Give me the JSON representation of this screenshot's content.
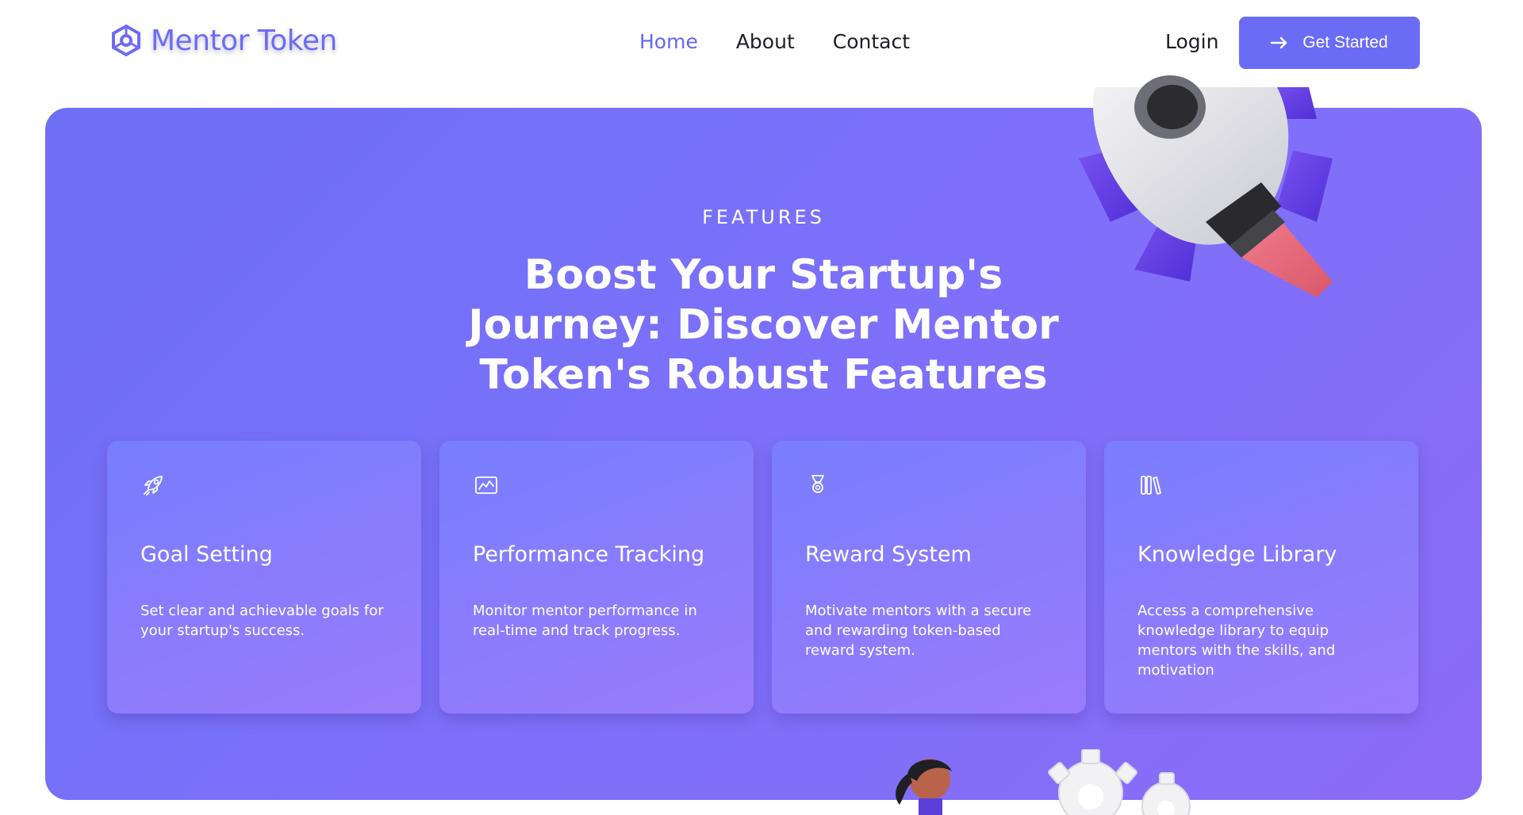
{
  "header": {
    "brand_name": "Mentor Token",
    "nav": [
      {
        "label": "Home",
        "active": true
      },
      {
        "label": "About",
        "active": false
      },
      {
        "label": "Contact",
        "active": false
      }
    ],
    "login_label": "Login",
    "cta_label": "Get Started"
  },
  "hero": {
    "eyebrow": "FEATURES",
    "title": "Boost Your Startup's Journey: Discover Mentor Token's Robust Features",
    "cards": [
      {
        "icon": "rocket-icon",
        "title": "Goal Setting",
        "description": "Set clear and achievable goals for your startup's success."
      },
      {
        "icon": "chart-icon",
        "title": "Performance Tracking",
        "description": "Monitor mentor performance in real-time and track progress."
      },
      {
        "icon": "medal-icon",
        "title": "Reward System",
        "description": "Motivate mentors with a secure and rewarding token-based reward system."
      },
      {
        "icon": "books-icon",
        "title": "Knowledge Library",
        "description": "Access a comprehensive knowledge library to equip mentors with the skills, and motivation"
      }
    ]
  },
  "colors": {
    "accent": "#6b6cf6",
    "hero_gradient_start": "#6d6ff5",
    "hero_gradient_end": "#8b6cf6",
    "text_dark": "#1d1d2b"
  }
}
